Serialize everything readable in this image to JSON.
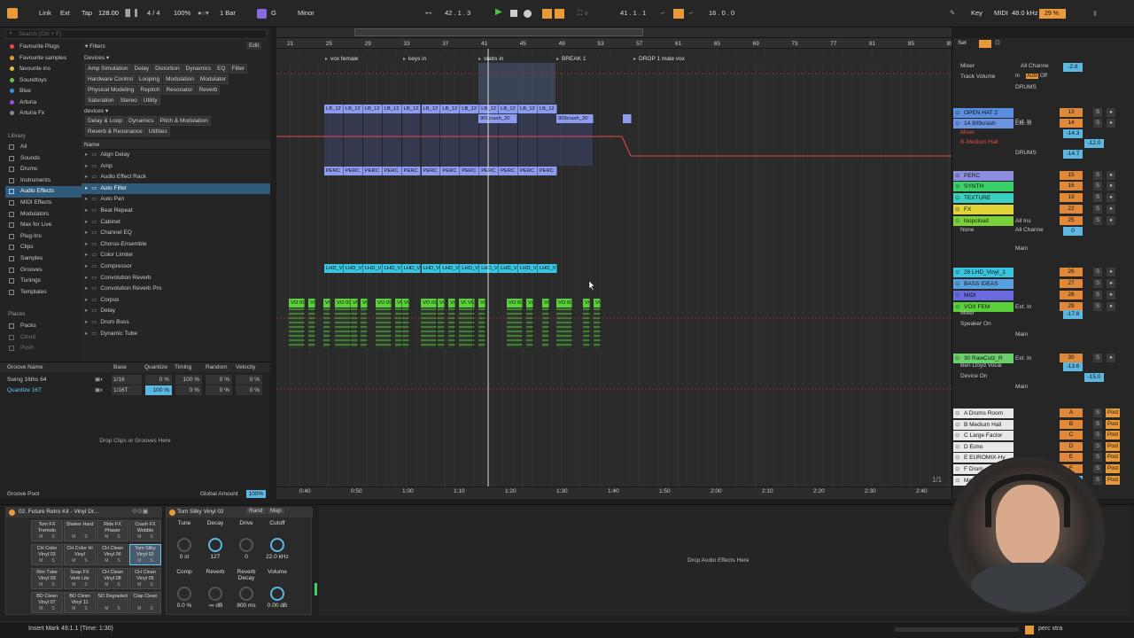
{
  "transport": {
    "link": "Link",
    "ext": "Ext",
    "tap": "Tap",
    "tempo": "128.00",
    "sig": "4 / 4",
    "zoom": "100%",
    "quant": "1 Bar",
    "key": "G",
    "scale": "Minor",
    "pos": "42 .  1 .  3",
    "loop_start": "41 .  1 .  1",
    "loop_len": "16 .  0 .  0",
    "key_btn": "Key",
    "midi": "MIDI",
    "sr": "48.0 kHz",
    "cpu": "29 %"
  },
  "sidebar": {
    "collections": [
      "Favourite Plugs",
      "Favourite samples",
      "favourite ins",
      "Soundtoys",
      "Blue",
      "Arturia",
      "Arturia Fx"
    ],
    "collection_colors": [
      "#e24b4b",
      "#e89a3a",
      "#e0c43a",
      "#6bc24a",
      "#3a8fe0",
      "#a04ae0",
      "#888"
    ],
    "library_label": "Library",
    "library": [
      "All",
      "Sounds",
      "Drums",
      "Instruments",
      "Audio Effects",
      "MIDI Effects",
      "Modulators",
      "Max for Live",
      "Plug-Ins",
      "Clips",
      "Samples",
      "Grooves",
      "Tunings",
      "Templates"
    ],
    "places_label": "Places",
    "places": [
      "Packs",
      "Cloud",
      "Push"
    ]
  },
  "browser": {
    "search_placeholder": "Search (Ctrl + F)",
    "filters": "Filters",
    "edit": "Edit",
    "devices_label": "Devices ▾",
    "devices_tags": [
      "Amp Simulation",
      "Delay",
      "Distortion",
      "Dynamics",
      "EQ",
      "Filter",
      "Hardware Control",
      "Looping",
      "Modulation",
      "Modulator",
      "Physical Modeling",
      "Repitch",
      "Resonator",
      "Reverb",
      "Saturation",
      "Stereo",
      "Utility"
    ],
    "devices2_label": "devices ▾",
    "devices2_tags": [
      "Delay & Loop",
      "Dynamics",
      "Pitch & Modulation",
      "Reverb & Resonance",
      "Utilities"
    ],
    "name_header": "Name",
    "items": [
      "Align Delay",
      "Amp",
      "Audio Effect Rack",
      "Auto Filter",
      "Auto Pan",
      "Beat Repeat",
      "Cabinet",
      "Channel EQ",
      "Chorus-Ensemble",
      "Color Limiter",
      "Compressor",
      "Convolution Reverb",
      "Convolution Reverb Pro",
      "Corpus",
      "Delay",
      "Drum Buss",
      "Dynamic Tube"
    ]
  },
  "groove": {
    "headers": [
      "Groove Name",
      "Base",
      "Quantize",
      "Timing",
      "Random",
      "Velocity"
    ],
    "rows": [
      [
        "Swing 16ths 64",
        "1/16",
        "0 %",
        "100 %",
        "0 %",
        "0 %"
      ],
      [
        "Quantize 16T",
        "1/16T",
        "100 %",
        "0 %",
        "0 %",
        "0 %"
      ]
    ],
    "drop": "Drop Clips or Grooves Here",
    "pool": "Groove Pool",
    "global_label": "Global Amount",
    "global_value": "100%"
  },
  "ruler": {
    "bars": [
      "21",
      "25",
      "29",
      "33",
      "37",
      "41",
      "45",
      "49",
      "53",
      "57",
      "61",
      "65",
      "69",
      "73",
      "77",
      "81",
      "85",
      "89"
    ],
    "times": [
      "0:40",
      "0:50",
      "1:00",
      "1:10",
      "1:20",
      "1:30",
      "1:40",
      "1:50",
      "2:00",
      "2:10",
      "2:20",
      "2:30",
      "2:40"
    ]
  },
  "locators": [
    "vox female",
    "keys in",
    "stabs in",
    "BREAK 1",
    "DROP 1 male vox"
  ],
  "clips": {
    "lb": "LB_12",
    "crash": "909crash_20",
    "perc": "PERC",
    "lhd": "LHD_V",
    "vox": "VO 09"
  },
  "tracks": [
    {
      "name": "Mixer",
      "row": "Track Volume"
    },
    {
      "name": "OPEN HAT 2",
      "num": "13"
    },
    {
      "name": "14 909crash",
      "num": "14",
      "io": "Ext. In"
    },
    {
      "name": "PERC",
      "num": "15"
    },
    {
      "name": "SYNTH",
      "num": "16"
    },
    {
      "name": "TEXTURE",
      "num": "19"
    },
    {
      "name": "FX",
      "num": "22"
    },
    {
      "name": "loopcloud",
      "num": "25",
      "io": "All Ins"
    },
    {
      "name": "26 LHD_Vinyl_1",
      "num": "26"
    },
    {
      "name": "BASS IDEAS",
      "num": "27"
    },
    {
      "name": "MIDI",
      "num": "28"
    },
    {
      "name": "VOX FEM",
      "num": "29",
      "io": "Ext. In"
    },
    {
      "name": "30 RawCutz_R",
      "num": "30",
      "io": "Ext. In"
    }
  ],
  "track_colors": [
    "#2a6b9e",
    "#5a8ee0",
    "#6a94e0",
    "#8e8ee0",
    "#3ad16b",
    "#3ad1c2",
    "#e0d43a",
    "#7ad13a",
    "#3ac4e0",
    "#5aa0e0",
    "#6a6ae0",
    "#5ad13a",
    "#6ad16a"
  ],
  "mixer": {
    "mixer": "Mixer",
    "track_volume": "Track Volume",
    "all_channels": "All Channe",
    "drums": "DRUMS",
    "in": "In",
    "auto": "Auto",
    "off": "Off",
    "main": "Main",
    "none": "None",
    "midi_vals": [
      "-2.8",
      "-14.3",
      "-12.0",
      "-14.7",
      "0",
      "-17.8",
      "-13.6",
      "-15.0"
    ],
    "reverb": "B-Medium Hall",
    "speaker": "Speaker On",
    "device_on": "Device On",
    "ben": "Ben Lloyd Vocal",
    "set": "Set"
  },
  "returns": [
    {
      "name": "A Drums Room",
      "l": "A"
    },
    {
      "name": "B Medium Hall",
      "l": "B"
    },
    {
      "name": "C Large Factor",
      "l": "C"
    },
    {
      "name": "D Echo",
      "l": "D"
    },
    {
      "name": "E EUROMIX-Hy",
      "l": "E"
    },
    {
      "name": "F Drum",
      "l": "F"
    },
    {
      "name": "Master",
      "l": "-12.0"
    }
  ],
  "page": "1/1",
  "drum": {
    "title": "02. Future Retro Kit - Vinyl Dr...",
    "pads": [
      "Tom FX Tremolo",
      "Shaker Hard",
      "Ride FX Phaser",
      "Crash FX Wobble",
      "CH Color Vinyl 03",
      "CH Color Hi Vinyl",
      "CH Clean Vinyl 06",
      "Tom Silky Vinyl 02",
      "Rim Tube Vinyl 03",
      "Snap FX Verb Lite",
      "CH Clean Vinyl 08",
      "CH Clean Vinyl 05",
      "BD Clean Vinyl 07",
      "BD Clean Vinyl 11",
      "SD Degraded",
      "Clap Clean"
    ],
    "pad_labels": [
      "M",
      "S"
    ]
  },
  "sample": {
    "title": "Tom Silky Vinyl 02",
    "rand": "Rand",
    "map": "Map",
    "knobs": [
      {
        "l": "Tune",
        "v": "0 st"
      },
      {
        "l": "Decay",
        "v": "127"
      },
      {
        "l": "Drive",
        "v": "0"
      },
      {
        "l": "Cutoff",
        "v": "22.0 kHz"
      },
      {
        "l": "Comp",
        "v": "0.0 %"
      },
      {
        "l": "Reverb",
        "v": "-∞ dB"
      },
      {
        "l": "Reverb Decay",
        "v": "800 ms"
      },
      {
        "l": "Volume",
        "v": "0.00 dB"
      }
    ]
  },
  "drop_fx": "Drop Audio Effects Here",
  "status": {
    "text": "Insert Mark 49.1.1 (Time: 1:30)",
    "track": "perc xtra"
  }
}
